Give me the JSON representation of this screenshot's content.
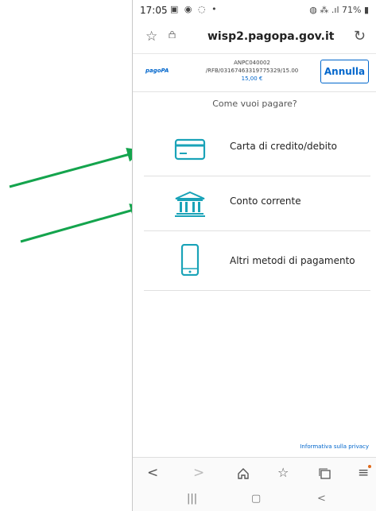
{
  "status_bar": {
    "time": "17:05",
    "left_icons": "▣ ◉ ◌ •",
    "right_text": "◍ ⁂ .ıl 71% ▮"
  },
  "browser": {
    "url": "wisp2.pagopa.gov.it"
  },
  "payment": {
    "logo_text": "pagoPA",
    "code": "ANPC040002",
    "reference": "/RFB/03167463319775329/15.00",
    "amount": "15,00 €",
    "cancel_label": "Annulla"
  },
  "question": "Come vuoi pagare?",
  "methods": [
    {
      "label": "Carta di credito/debito",
      "icon": "credit-card-icon"
    },
    {
      "label": "Conto corrente",
      "icon": "bank-icon"
    },
    {
      "label": "Altri metodi di pagamento",
      "icon": "smartphone-icon"
    }
  ],
  "privacy_link": "Informativa sulla privacy",
  "colors": {
    "accent": "#0066cc",
    "icon": "#1aa3b8",
    "annotation_arrow": "#14a44d"
  }
}
